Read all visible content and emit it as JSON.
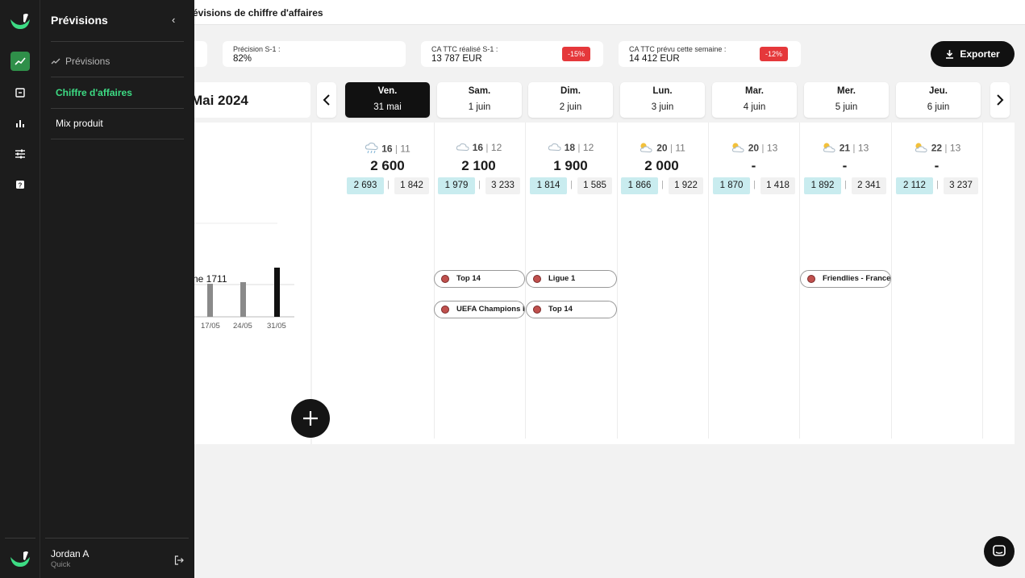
{
  "header": {
    "title": "évisions de chiffre d'affaires"
  },
  "sidebar": {
    "title": "Prévisions",
    "items": [
      {
        "label": "Prévisions"
      },
      {
        "label": "Chiffre d'affaires"
      },
      {
        "label": "Mix produit"
      }
    ],
    "user": {
      "name": "Jordan A",
      "org": "Quick"
    },
    "accent": "#3ddc84"
  },
  "kpis": [
    {
      "label": "Précision S-1 :",
      "value": "82%"
    },
    {
      "label": "CA TTC réalisé S-1 :",
      "value": "13 787 EUR",
      "badge": "-15%"
    },
    {
      "label": "CA TTC prévu cette semaine :",
      "value": "14 412 EUR",
      "badge": "-12%"
    }
  ],
  "export_label": "Exporter",
  "month_label": "Mai 2024",
  "chart_data": {
    "type": "bar",
    "categories": [
      "17/05",
      "24/05",
      "31/05"
    ],
    "annotation": "ne 1711"
  },
  "days": [
    {
      "name": "Ven.",
      "date": "31 mai",
      "icon": "rain-icon",
      "hi": "16",
      "lo": "11",
      "forecast": "2 600",
      "a": "2 693",
      "b": "1 842",
      "selected": true
    },
    {
      "name": "Sam.",
      "date": "1 juin",
      "icon": "cloud-icon",
      "hi": "16",
      "lo": "12",
      "forecast": "2 100",
      "a": "1 979",
      "b": "3 233"
    },
    {
      "name": "Dim.",
      "date": "2 juin",
      "icon": "cloud-icon",
      "hi": "18",
      "lo": "12",
      "forecast": "1 900",
      "a": "1 814",
      "b": "1 585"
    },
    {
      "name": "Lun.",
      "date": "3 juin",
      "icon": "partly-sunny-icon",
      "hi": "20",
      "lo": "11",
      "forecast": "2 000",
      "a": "1 866",
      "b": "1 922"
    },
    {
      "name": "Mar.",
      "date": "4 juin",
      "icon": "partly-sunny-icon",
      "hi": "20",
      "lo": "13",
      "forecast": "-",
      "a": "1 870",
      "b": "1 418"
    },
    {
      "name": "Mer.",
      "date": "5 juin",
      "icon": "partly-sunny-icon",
      "hi": "21",
      "lo": "13",
      "forecast": "-",
      "a": "1 892",
      "b": "2 341"
    },
    {
      "name": "Jeu.",
      "date": "6 juin",
      "icon": "partly-sunny-icon",
      "hi": "22",
      "lo": "13",
      "forecast": "-",
      "a": "2 112",
      "b": "3 237"
    }
  ],
  "events": [
    {
      "label": "Top 14"
    },
    {
      "label": "UEFA Champions League"
    },
    {
      "label": "Ligue 1"
    },
    {
      "label": "Top 14"
    },
    {
      "label": "Friendlies - France"
    }
  ]
}
